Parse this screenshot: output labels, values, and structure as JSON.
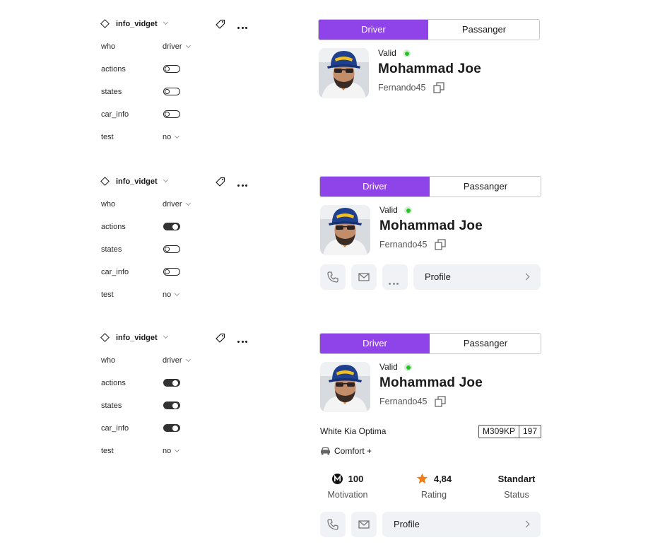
{
  "component": {
    "name": "info_vidget"
  },
  "props": {
    "who_label": "who",
    "who_value": "driver",
    "actions_label": "actions",
    "states_label": "states",
    "car_info_label": "car_info",
    "test_label": "test",
    "test_value": "no"
  },
  "variants": [
    {
      "actions": false,
      "states": false,
      "car_info": false
    },
    {
      "actions": true,
      "states": false,
      "car_info": false
    },
    {
      "actions": true,
      "states": true,
      "car_info": true
    }
  ],
  "segmented": {
    "driver_label": "Driver",
    "passenger_label": "Passanger",
    "active_color": "#8e44e8"
  },
  "driver": {
    "status": "Valid",
    "status_color": "#22c322",
    "name": "Mohammad Joe",
    "nickname": "Fernando45"
  },
  "actions": {
    "phone_icon": "phone-icon",
    "mail_icon": "mail-icon",
    "more_icon": "more-horizontal-icon",
    "profile_label": "Profile"
  },
  "car": {
    "name": "White Kia Optima",
    "plate_number": "M309KP",
    "plate_region": "197",
    "class": "Comfort +"
  },
  "stats": {
    "motivation_value": "100",
    "motivation_label": "Motivation",
    "rating_value": "4,84",
    "rating_label": "Rating",
    "status_value": "Standart",
    "status_label": "Status",
    "rating_icon_color": "#f07c1a"
  }
}
